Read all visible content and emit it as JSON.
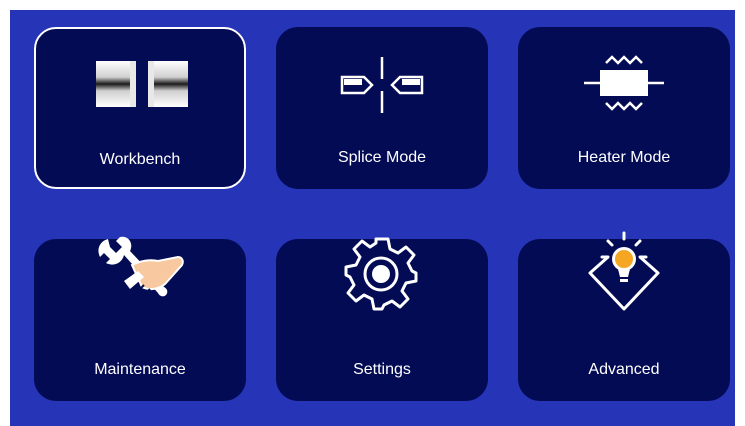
{
  "menu": {
    "tiles": [
      {
        "label": "Workbench",
        "icon": "fiber-workbench-icon",
        "selected": true
      },
      {
        "label": "Splice Mode",
        "icon": "splice-alignment-icon",
        "selected": false
      },
      {
        "label": "Heater Mode",
        "icon": "heater-sleeve-icon",
        "selected": false
      },
      {
        "label": "Maintenance",
        "icon": "wrench-hand-icon",
        "selected": false
      },
      {
        "label": "Settings",
        "icon": "gear-icon",
        "selected": false
      },
      {
        "label": "Advanced",
        "icon": "lightbulb-icon",
        "selected": false
      }
    ]
  },
  "colors": {
    "background": "#2635b7",
    "tile": "#030b54",
    "selected_border": "#ffffff",
    "text": "#ffffff",
    "bulb": "#f5a623",
    "skin": "#f8c9a0"
  }
}
